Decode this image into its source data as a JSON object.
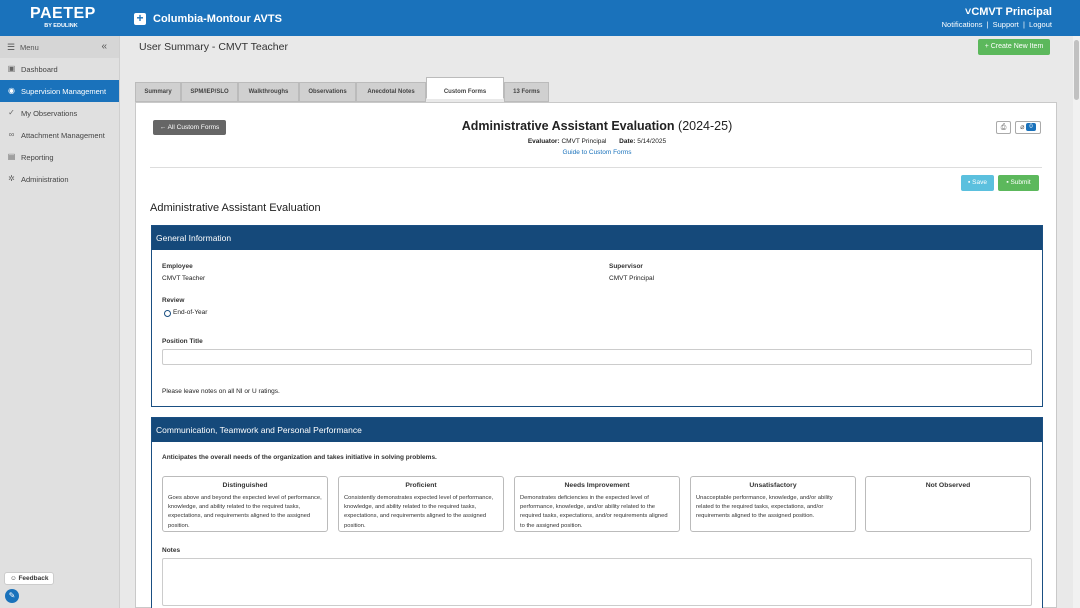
{
  "topbar": {
    "logo_main": "PAETEP",
    "logo_sub": "BY EDULINK",
    "site_name": "Columbia-Montour AVTS",
    "user_name": "CMVT Principal",
    "links": [
      "Notifications",
      "Support",
      "Logout"
    ]
  },
  "sidebar": {
    "menu_label": "Menu",
    "items": [
      {
        "label": "Dashboard",
        "icon": "dashboard-icon"
      },
      {
        "label": "Supervision Management",
        "icon": "supervision-icon"
      },
      {
        "label": "My Observations",
        "icon": "check-icon"
      },
      {
        "label": "Attachment Management",
        "icon": "link-icon"
      },
      {
        "label": "Reporting",
        "icon": "chart-icon"
      },
      {
        "label": "Administration",
        "icon": "gear-icon"
      }
    ],
    "feedback_label": "Feedback"
  },
  "header": {
    "title": "User Summary - CMVT Teacher",
    "create_label": "+ Create New Item"
  },
  "tabs": [
    "Summary",
    "SPM/IEP/SLO",
    "Walkthroughs",
    "Observations",
    "Anecdotal Notes",
    "Custom Forms",
    "13 Forms"
  ],
  "form": {
    "back_label": "← All Custom Forms",
    "title_bold": "Administrative Assistant Evaluation",
    "title_year": "(2024-25)",
    "evaluator_label": "Evaluator:",
    "evaluator_value": "CMVT Principal",
    "date_label": "Date:",
    "date_value": "5/14/2025",
    "guide_link": "Guide to Custom Forms",
    "attachment_count": "0",
    "save_label": "Save",
    "submit_label": "Submit",
    "name": "Administrative Assistant Evaluation"
  },
  "general": {
    "header": "General Information",
    "employee_label": "Employee",
    "employee_value": "CMVT Teacher",
    "supervisor_label": "Supervisor",
    "supervisor_value": "CMVT Principal",
    "review_label": "Review",
    "review_option": "End-of-Year",
    "position_label": "Position Title",
    "position_value": "",
    "notes_hint": "Please leave notes on all NI or U ratings."
  },
  "communication": {
    "header": "Communication, Teamwork and Personal Performance",
    "criterion": "Anticipates the overall needs of the organization and takes initiative in solving problems.",
    "ratings": [
      {
        "title": "Distinguished",
        "desc": "Goes above and beyond the expected level of performance, knowledge, and ability related to the required tasks, expectations, and requirements aligned to the assigned position."
      },
      {
        "title": "Proficient",
        "desc": "Consistently demonstrates expected level of performance, knowledge, and ability related to the required tasks, expectations, and requirements aligned to the assigned position."
      },
      {
        "title": "Needs Improvement",
        "desc": "Demonstrates deficiencies in the expected level of performance, knowledge, and/or ability related to the required tasks, expectations, and/or requirements aligned to the assigned position."
      },
      {
        "title": "Unsatisfactory",
        "desc": "Unacceptable performance, knowledge, and/or ability related to the required tasks, expectations, and/or requirements aligned to the assigned position."
      },
      {
        "title": "Not Observed",
        "desc": ""
      }
    ],
    "notes_label": "Notes",
    "notes_value": ""
  }
}
